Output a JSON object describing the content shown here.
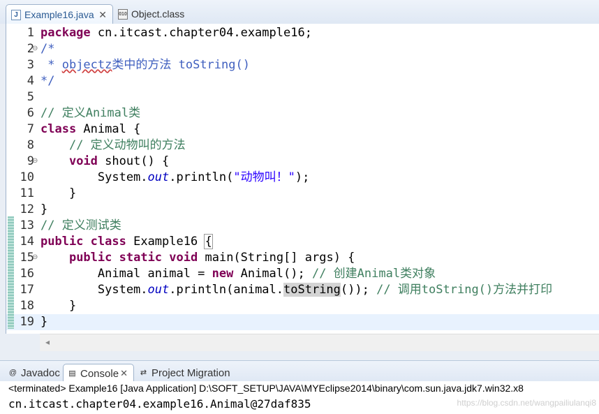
{
  "editor_tabs": [
    {
      "label": "Example16.java",
      "icon": "java-file-icon",
      "close": "✕"
    },
    {
      "label": "Object.class",
      "icon": "class-file-icon"
    }
  ],
  "lines": [
    {
      "num": "1",
      "tokens": [
        {
          "t": "package",
          "c": "kw"
        },
        {
          "t": " cn.itcast.chapter04.example16;"
        }
      ]
    },
    {
      "num": "2",
      "fold": "⊖",
      "tokens": [
        {
          "t": "/*",
          "c": "jd"
        }
      ]
    },
    {
      "num": "3",
      "tokens": [
        {
          "t": " * ",
          "c": "jd"
        },
        {
          "t": "objectz",
          "c": "jd sq"
        },
        {
          "t": "类中的方法 toString()",
          "c": "jd"
        }
      ]
    },
    {
      "num": "4",
      "tokens": [
        {
          "t": "*/",
          "c": "jd"
        }
      ]
    },
    {
      "num": "5",
      "tokens": []
    },
    {
      "num": "6",
      "tokens": [
        {
          "t": "// 定义Animal类",
          "c": "cm"
        }
      ]
    },
    {
      "num": "7",
      "tokens": [
        {
          "t": "class",
          "c": "kw"
        },
        {
          "t": " Animal {"
        }
      ]
    },
    {
      "num": "8",
      "tokens": [
        {
          "t": "    "
        },
        {
          "t": "// 定义动物叫的方法",
          "c": "cm"
        }
      ]
    },
    {
      "num": "9",
      "fold": "⊖",
      "tokens": [
        {
          "t": "    "
        },
        {
          "t": "void",
          "c": "kw"
        },
        {
          "t": " shout() {"
        }
      ]
    },
    {
      "num": "10",
      "tokens": [
        {
          "t": "        System."
        },
        {
          "t": "out",
          "c": "fld"
        },
        {
          "t": ".println("
        },
        {
          "t": "\"动物叫！\"",
          "c": "st"
        },
        {
          "t": ");"
        }
      ]
    },
    {
      "num": "11",
      "tokens": [
        {
          "t": "    }"
        }
      ]
    },
    {
      "num": "12",
      "tokens": [
        {
          "t": "}"
        }
      ]
    },
    {
      "num": "13",
      "tokens": [
        {
          "t": "// 定义测试类",
          "c": "cm"
        }
      ]
    },
    {
      "num": "14",
      "tokens": [
        {
          "t": "public",
          "c": "kw"
        },
        {
          "t": " "
        },
        {
          "t": "class",
          "c": "kw"
        },
        {
          "t": " Example16 "
        },
        {
          "t": "{",
          "c": "bracket"
        }
      ]
    },
    {
      "num": "15",
      "fold": "⊖",
      "tokens": [
        {
          "t": "    "
        },
        {
          "t": "public",
          "c": "kw"
        },
        {
          "t": " "
        },
        {
          "t": "static",
          "c": "kw"
        },
        {
          "t": " "
        },
        {
          "t": "void",
          "c": "kw"
        },
        {
          "t": " main(String[] args) {"
        }
      ]
    },
    {
      "num": "16",
      "tokens": [
        {
          "t": "        Animal animal = "
        },
        {
          "t": "new",
          "c": "kw"
        },
        {
          "t": " Animal(); "
        },
        {
          "t": "// 创建Animal类对象",
          "c": "cm"
        }
      ]
    },
    {
      "num": "17",
      "tokens": [
        {
          "t": "        System."
        },
        {
          "t": "out",
          "c": "fld"
        },
        {
          "t": ".println(animal."
        },
        {
          "t": "toString",
          "c": "hl"
        },
        {
          "t": "()); "
        },
        {
          "t": "// 调用toString()方法并打印",
          "c": "cm"
        }
      ]
    },
    {
      "num": "18",
      "tokens": [
        {
          "t": "    }"
        }
      ]
    },
    {
      "num": "19",
      "current": true,
      "tokens": [
        {
          "t": "}"
        }
      ]
    }
  ],
  "scroll_arrow": "◂",
  "panel_tabs": [
    {
      "label": "Javadoc",
      "icon": "at-sign-icon",
      "glyph": "@"
    },
    {
      "label": "Console",
      "icon": "console-icon",
      "glyph": "▤",
      "close": "✕",
      "active": true
    },
    {
      "label": "Project Migration",
      "icon": "migration-icon",
      "glyph": "⇄"
    }
  ],
  "console": {
    "status": "<terminated> Example16 [Java Application] D:\\SOFT_SETUP\\JAVA\\MYEclipse2014\\binary\\com.sun.java.jdk7.win32.x8",
    "output": "cn.itcast.chapter04.example16.Animal@27daf835",
    "watermark": "https://blog.csdn.net/wangpailiulanqi8"
  }
}
